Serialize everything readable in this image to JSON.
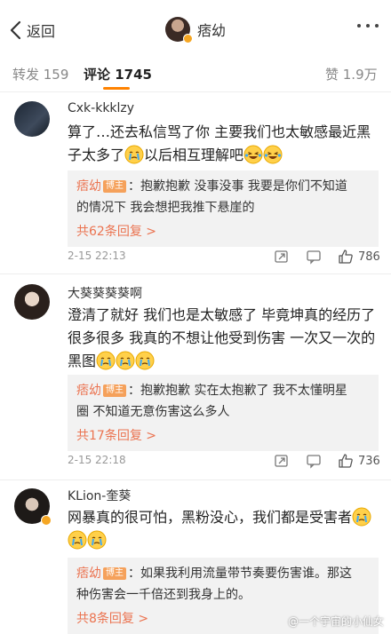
{
  "nav": {
    "back_label": "返回",
    "title": "痞幼"
  },
  "tabs": {
    "repost": "转发 159",
    "comment": "评论 1745",
    "like": "赞 1.9万"
  },
  "comments": [
    {
      "username": "Cxk-kkklzy",
      "text_1": "算了…还去私信骂了你 主要我们也太敏感最近黑",
      "text_2": "子太多了",
      "text_3": "以后相互理解吧",
      "reply_author": "痞幼",
      "badge": "博主",
      "reply_1": "：抱歉抱歉 没事没事 我要是你们不知道",
      "reply_2": "的情况下 我会想把我推下悬崖的",
      "reply_more": "共62条回复 >",
      "time": "2-15 22:13",
      "likes": "786"
    },
    {
      "username": "大葵葵葵葵啊",
      "text_1": "澄清了就好 我们也是太敏感了 毕竟坤真的经历了",
      "text_2": "很多很多 我真的不想让他受到伤害 一次又一次的",
      "text_3": "黑图",
      "reply_author": "痞幼",
      "badge": "博主",
      "reply_1": "：抱歉抱歉 实在太抱歉了 我不太懂明星",
      "reply_2": "圈 不知道无意伤害这么多人",
      "reply_more": "共17条回复 >",
      "time": "2-15 22:18",
      "likes": "736"
    },
    {
      "username": "KLion-奎葵",
      "text_1": "网暴真的很可怕，黑粉没心，我们都是受害者",
      "reply_author": "痞幼",
      "badge": "博主",
      "reply_1": "：如果我利用流量带节奏要伤害谁。那这",
      "reply_2": "种伤害会一千倍还到我身上的。",
      "reply_more": "共8条回复 >"
    }
  ],
  "watermark": "@一个宇宙的小仙女",
  "colors": {
    "accent": "#ff8200",
    "reply_name": "#eb7350",
    "blogger_badge": "#f5a15b"
  }
}
